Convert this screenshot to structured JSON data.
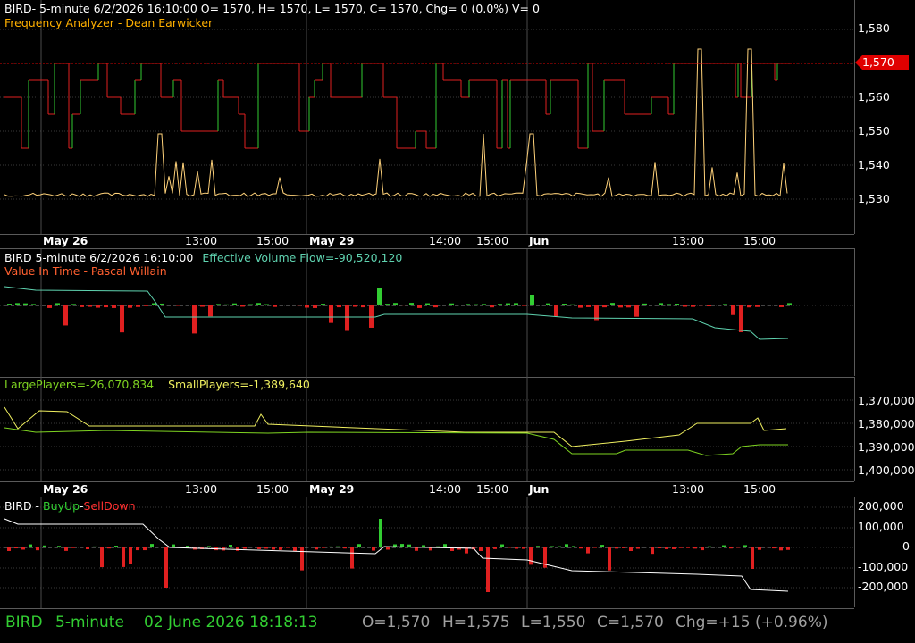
{
  "pane1": {
    "header": "BIRD- 5-minute 6/2/2026 16:10:00 O= 1570, H= 1570, L= 1570, C= 1570, Chg= 0 (0.0%) V= 0",
    "indicator": "Frequency Analyzer - Dean Earwicker",
    "y_ticks": [
      "1,580",
      "1,570",
      "1,560",
      "1,550",
      "1,540",
      "1,530"
    ],
    "last_price": "1,570"
  },
  "date_axis": {
    "labels": [
      "May 26",
      "13:00",
      "15:00",
      "May 29",
      "14:00",
      "15:00",
      "Jun",
      "13:00",
      "15:00"
    ]
  },
  "pane2": {
    "header": "BIRD 5-minute  6/2/2026 16:10:00",
    "flow": "Effective Volume Flow=-90,520,120",
    "indicator": "Value In Time - Pascal Willain"
  },
  "pane3": {
    "large": "LargePlayers=-26,070,834",
    "small": "SmallPlayers=-1,389,640",
    "y_ticks": [
      "1,370,000",
      "1,380,000",
      "1,390,000",
      "1,400,000"
    ]
  },
  "pane4": {
    "symbol": "BIRD",
    "sep1": " - ",
    "buy": "BuyUp",
    "sep2": "-",
    "sell": "SellDown",
    "y_ticks": [
      "200,000",
      "100,000",
      "0",
      "-100,000",
      "-200,000"
    ]
  },
  "status": {
    "symbol": "BIRD",
    "interval": "5-minute",
    "datetime": "02 June 2026 18:18:13",
    "open": "O=1,570",
    "high": "H=1,575",
    "low": "L=1,550",
    "close": "C=1,570",
    "chg": "Chg=+15 (+0.96%)"
  },
  "colors": {
    "background": "#000000",
    "up": "#32cd32",
    "down": "#e02020",
    "analyzer": "#ffd27a",
    "flow": "#5fd3b0",
    "indicator_title": "#ff6030",
    "large": "#7ed321",
    "small": "#f0f060",
    "status": "#32cd32",
    "status_values": "#a0a0a0"
  }
}
